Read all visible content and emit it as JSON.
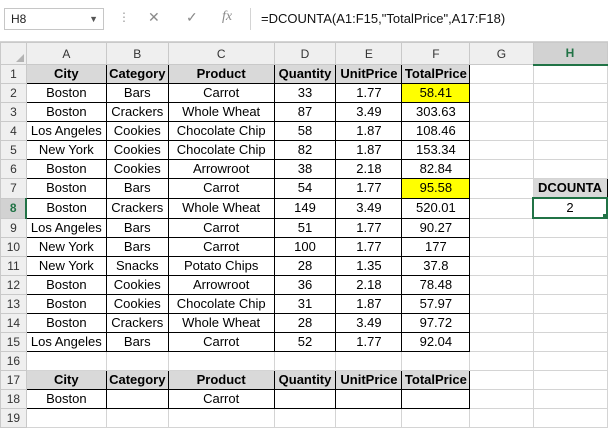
{
  "name_box": "H8",
  "formula_bar": {
    "cancel_icon": "✕",
    "enter_icon": "✓",
    "fx_label": "fx",
    "formula": "=DCOUNTA(A1:F15,\"TotalPrice\",A17:F18)"
  },
  "columns": [
    "A",
    "B",
    "C",
    "D",
    "E",
    "F",
    "G",
    "H"
  ],
  "rows": [
    {
      "num": "1",
      "cells": [
        {
          "v": "City",
          "s": "hdr"
        },
        {
          "v": "Category",
          "s": "hdr"
        },
        {
          "v": "Product",
          "s": "hdr"
        },
        {
          "v": "Quantity",
          "s": "hdr"
        },
        {
          "v": "UnitPrice",
          "s": "hdr"
        },
        {
          "v": "TotalPrice",
          "s": "hdr"
        },
        {
          "v": "",
          "s": ""
        },
        {
          "v": "",
          "s": ""
        }
      ]
    },
    {
      "num": "2",
      "cells": [
        {
          "v": "Boston",
          "s": "b"
        },
        {
          "v": "Bars",
          "s": "b"
        },
        {
          "v": "Carrot",
          "s": "b"
        },
        {
          "v": "33",
          "s": "b"
        },
        {
          "v": "1.77",
          "s": "b"
        },
        {
          "v": "58.41",
          "s": "b yellow"
        },
        {
          "v": "",
          "s": ""
        },
        {
          "v": "",
          "s": ""
        }
      ]
    },
    {
      "num": "3",
      "cells": [
        {
          "v": "Boston",
          "s": "b"
        },
        {
          "v": "Crackers",
          "s": "b"
        },
        {
          "v": "Whole Wheat",
          "s": "b"
        },
        {
          "v": "87",
          "s": "b"
        },
        {
          "v": "3.49",
          "s": "b"
        },
        {
          "v": "303.63",
          "s": "b"
        },
        {
          "v": "",
          "s": ""
        },
        {
          "v": "",
          "s": ""
        }
      ]
    },
    {
      "num": "4",
      "cells": [
        {
          "v": "Los Angeles",
          "s": "b"
        },
        {
          "v": "Cookies",
          "s": "b"
        },
        {
          "v": "Chocolate Chip",
          "s": "b"
        },
        {
          "v": "58",
          "s": "b"
        },
        {
          "v": "1.87",
          "s": "b"
        },
        {
          "v": "108.46",
          "s": "b"
        },
        {
          "v": "",
          "s": ""
        },
        {
          "v": "",
          "s": ""
        }
      ]
    },
    {
      "num": "5",
      "cells": [
        {
          "v": "New York",
          "s": "b"
        },
        {
          "v": "Cookies",
          "s": "b"
        },
        {
          "v": "Chocolate Chip",
          "s": "b"
        },
        {
          "v": "82",
          "s": "b"
        },
        {
          "v": "1.87",
          "s": "b"
        },
        {
          "v": "153.34",
          "s": "b"
        },
        {
          "v": "",
          "s": ""
        },
        {
          "v": "",
          "s": ""
        }
      ]
    },
    {
      "num": "6",
      "cells": [
        {
          "v": "Boston",
          "s": "b"
        },
        {
          "v": "Cookies",
          "s": "b"
        },
        {
          "v": "Arrowroot",
          "s": "b"
        },
        {
          "v": "38",
          "s": "b"
        },
        {
          "v": "2.18",
          "s": "b"
        },
        {
          "v": "82.84",
          "s": "b"
        },
        {
          "v": "",
          "s": ""
        },
        {
          "v": "",
          "s": ""
        }
      ]
    },
    {
      "num": "7",
      "cells": [
        {
          "v": "Boston",
          "s": "b"
        },
        {
          "v": "Bars",
          "s": "b"
        },
        {
          "v": "Carrot",
          "s": "b"
        },
        {
          "v": "54",
          "s": "b"
        },
        {
          "v": "1.77",
          "s": "b"
        },
        {
          "v": "95.58",
          "s": "b yellow"
        },
        {
          "v": "",
          "s": ""
        },
        {
          "v": "DCOUNTA",
          "s": "hdr"
        }
      ]
    },
    {
      "num": "8",
      "cells": [
        {
          "v": "Boston",
          "s": "b"
        },
        {
          "v": "Crackers",
          "s": "b"
        },
        {
          "v": "Whole Wheat",
          "s": "b"
        },
        {
          "v": "149",
          "s": "b"
        },
        {
          "v": "3.49",
          "s": "b"
        },
        {
          "v": "520.01",
          "s": "b"
        },
        {
          "v": "",
          "s": ""
        },
        {
          "v": "2",
          "s": "sel"
        }
      ]
    },
    {
      "num": "9",
      "cells": [
        {
          "v": "Los Angeles",
          "s": "b"
        },
        {
          "v": "Bars",
          "s": "b"
        },
        {
          "v": "Carrot",
          "s": "b"
        },
        {
          "v": "51",
          "s": "b"
        },
        {
          "v": "1.77",
          "s": "b"
        },
        {
          "v": "90.27",
          "s": "b"
        },
        {
          "v": "",
          "s": ""
        },
        {
          "v": "",
          "s": ""
        }
      ]
    },
    {
      "num": "10",
      "cells": [
        {
          "v": "New York",
          "s": "b"
        },
        {
          "v": "Bars",
          "s": "b"
        },
        {
          "v": "Carrot",
          "s": "b"
        },
        {
          "v": "100",
          "s": "b"
        },
        {
          "v": "1.77",
          "s": "b"
        },
        {
          "v": "177",
          "s": "b"
        },
        {
          "v": "",
          "s": ""
        },
        {
          "v": "",
          "s": ""
        }
      ]
    },
    {
      "num": "11",
      "cells": [
        {
          "v": "New York",
          "s": "b"
        },
        {
          "v": "Snacks",
          "s": "b"
        },
        {
          "v": "Potato Chips",
          "s": "b"
        },
        {
          "v": "28",
          "s": "b"
        },
        {
          "v": "1.35",
          "s": "b"
        },
        {
          "v": "37.8",
          "s": "b"
        },
        {
          "v": "",
          "s": ""
        },
        {
          "v": "",
          "s": ""
        }
      ]
    },
    {
      "num": "12",
      "cells": [
        {
          "v": "Boston",
          "s": "b"
        },
        {
          "v": "Cookies",
          "s": "b"
        },
        {
          "v": "Arrowroot",
          "s": "b"
        },
        {
          "v": "36",
          "s": "b"
        },
        {
          "v": "2.18",
          "s": "b"
        },
        {
          "v": "78.48",
          "s": "b"
        },
        {
          "v": "",
          "s": ""
        },
        {
          "v": "",
          "s": ""
        }
      ]
    },
    {
      "num": "13",
      "cells": [
        {
          "v": "Boston",
          "s": "b"
        },
        {
          "v": "Cookies",
          "s": "b"
        },
        {
          "v": "Chocolate Chip",
          "s": "b"
        },
        {
          "v": "31",
          "s": "b"
        },
        {
          "v": "1.87",
          "s": "b"
        },
        {
          "v": "57.97",
          "s": "b"
        },
        {
          "v": "",
          "s": ""
        },
        {
          "v": "",
          "s": ""
        }
      ]
    },
    {
      "num": "14",
      "cells": [
        {
          "v": "Boston",
          "s": "b"
        },
        {
          "v": "Crackers",
          "s": "b"
        },
        {
          "v": "Whole Wheat",
          "s": "b"
        },
        {
          "v": "28",
          "s": "b"
        },
        {
          "v": "3.49",
          "s": "b"
        },
        {
          "v": "97.72",
          "s": "b"
        },
        {
          "v": "",
          "s": ""
        },
        {
          "v": "",
          "s": ""
        }
      ]
    },
    {
      "num": "15",
      "cells": [
        {
          "v": "Los Angeles",
          "s": "b"
        },
        {
          "v": "Bars",
          "s": "b"
        },
        {
          "v": "Carrot",
          "s": "b"
        },
        {
          "v": "52",
          "s": "b"
        },
        {
          "v": "1.77",
          "s": "b"
        },
        {
          "v": "92.04",
          "s": "b"
        },
        {
          "v": "",
          "s": ""
        },
        {
          "v": "",
          "s": ""
        }
      ]
    },
    {
      "num": "16",
      "cells": [
        {
          "v": "",
          "s": ""
        },
        {
          "v": "",
          "s": ""
        },
        {
          "v": "",
          "s": ""
        },
        {
          "v": "",
          "s": ""
        },
        {
          "v": "",
          "s": ""
        },
        {
          "v": "",
          "s": ""
        },
        {
          "v": "",
          "s": ""
        },
        {
          "v": "",
          "s": ""
        }
      ]
    },
    {
      "num": "17",
      "cells": [
        {
          "v": "City",
          "s": "hdr"
        },
        {
          "v": "Category",
          "s": "hdr"
        },
        {
          "v": "Product",
          "s": "hdr"
        },
        {
          "v": "Quantity",
          "s": "hdr"
        },
        {
          "v": "UnitPrice",
          "s": "hdr"
        },
        {
          "v": "TotalPrice",
          "s": "hdr"
        },
        {
          "v": "",
          "s": ""
        },
        {
          "v": "",
          "s": ""
        }
      ]
    },
    {
      "num": "18",
      "cells": [
        {
          "v": "Boston",
          "s": "b"
        },
        {
          "v": "",
          "s": "b"
        },
        {
          "v": "Carrot",
          "s": "b"
        },
        {
          "v": "",
          "s": "b"
        },
        {
          "v": "",
          "s": "b"
        },
        {
          "v": "",
          "s": "b"
        },
        {
          "v": "",
          "s": ""
        },
        {
          "v": "",
          "s": ""
        }
      ]
    },
    {
      "num": "19",
      "cells": [
        {
          "v": "",
          "s": ""
        },
        {
          "v": "",
          "s": ""
        },
        {
          "v": "",
          "s": ""
        },
        {
          "v": "",
          "s": ""
        },
        {
          "v": "",
          "s": ""
        },
        {
          "v": "",
          "s": ""
        },
        {
          "v": "",
          "s": ""
        },
        {
          "v": "",
          "s": ""
        }
      ]
    }
  ],
  "selected": {
    "col": "H",
    "row": "8"
  },
  "colors": {
    "accent": "#217346",
    "highlight": "#ffff00",
    "header_fill": "#d9d9d9"
  }
}
